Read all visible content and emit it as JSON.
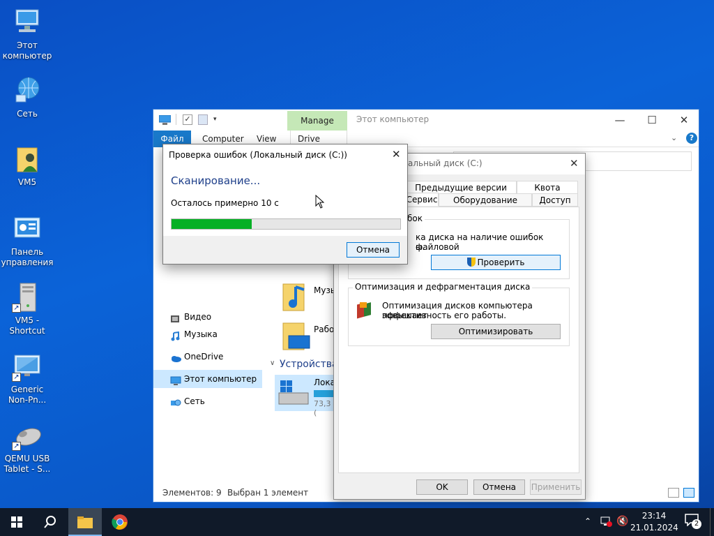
{
  "desktop": {
    "icons": [
      {
        "label": "Этот\nкомпьютер",
        "icon": "computer-icon"
      },
      {
        "label": "Сеть",
        "icon": "network-icon"
      },
      {
        "label": "VM5",
        "icon": "user-folder-icon"
      },
      {
        "label": "Панель\nуправления",
        "icon": "control-panel-icon"
      },
      {
        "label": "VM5 -\nShortcut",
        "icon": "server-icon"
      },
      {
        "label": "Generic\nNon-Pn...",
        "icon": "monitor-icon"
      },
      {
        "label": "QEMU USB\nTablet - S...",
        "icon": "mouse-icon"
      }
    ]
  },
  "explorer": {
    "title": "Этот компьютер",
    "manage_tab": "Manage",
    "tabs": [
      "Файл",
      "Computer",
      "View",
      "Drive Tools"
    ],
    "nav": {
      "items": [
        {
          "label": "Видео",
          "icon": "video-icon"
        },
        {
          "label": "Музыка",
          "icon": "music-icon"
        },
        {
          "label": "OneDrive",
          "icon": "onedrive-icon"
        },
        {
          "label": "Этот компьютер",
          "icon": "computer-icon"
        },
        {
          "label": "Сеть",
          "icon": "network-icon"
        }
      ]
    },
    "content": {
      "folder_music": "Музы",
      "folder_desktop": "Рабо",
      "devices_header": "Устройства",
      "drive_label": "Лока",
      "drive_free": "73,3 ("
    },
    "status": {
      "count": "Элементов: 9",
      "selected": "Выбран 1 элемент"
    }
  },
  "properties": {
    "title": "альный диск (C:)",
    "tabs_row1": [
      "Предыдущие версии",
      "Квота"
    ],
    "tabs_row2": [
      "Сервис",
      "Оборудование",
      "Доступ"
    ],
    "group1": {
      "title": "аличие ошибок",
      "text_line1": "ка диска на наличие ошибок файловой",
      "text_line2": "ы.",
      "button": "Проверить"
    },
    "group2": {
      "title": "Оптимизация и дефрагментация диска",
      "text_line1": "Оптимизация дисков компьютера повышает",
      "text_line2": "эффективность его работы.",
      "button": "Оптимизировать"
    },
    "buttons": {
      "ok": "OK",
      "cancel": "Отмена",
      "apply": "Применить"
    }
  },
  "error_check": {
    "title": "Проверка ошибок (Локальный диск (C:))",
    "heading": "Сканирование...",
    "remaining": "Осталось примерно 10 с",
    "progress": 0.35,
    "cancel": "Отмена",
    "accent": "#06b025"
  },
  "taskbar": {
    "time": "23:14",
    "date": "21.01.2024",
    "notifications": "2"
  },
  "colors": {
    "accent": "#0078d7",
    "heading": "#1e3f8a",
    "manage": "#c5e8b7"
  }
}
